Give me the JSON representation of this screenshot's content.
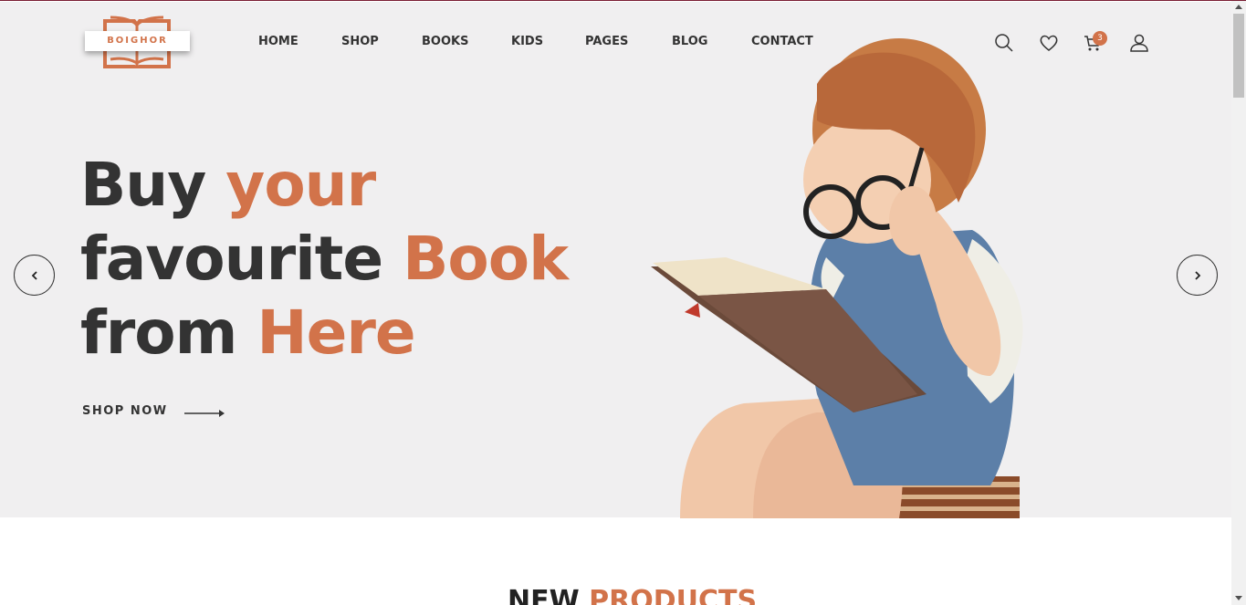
{
  "brand": {
    "name": "BOIGHOR",
    "accent_color": "#d2734a",
    "text_color": "#333333",
    "hero_background": "#f0eff0"
  },
  "nav": {
    "items": [
      {
        "label": "HOME"
      },
      {
        "label": "SHOP"
      },
      {
        "label": "BOOKS"
      },
      {
        "label": "KIDS"
      },
      {
        "label": "PAGES"
      },
      {
        "label": "BLOG"
      },
      {
        "label": "CONTACT"
      }
    ]
  },
  "header_icons": {
    "search": "search-icon",
    "wishlist": "heart-icon",
    "cart": "cart-icon",
    "cart_count": "3",
    "account": "user-icon"
  },
  "hero": {
    "line1_plain": "Buy ",
    "line1_accent": "your",
    "line2_plain": "favourite ",
    "line2_accent": "Book",
    "line3_plain": "from ",
    "line3_accent": "Here",
    "cta_label": "SHOP NOW",
    "prev_icon": "chevron-left-icon",
    "next_icon": "chevron-right-icon"
  },
  "section": {
    "title_plain": "NEW ",
    "title_accent": "PRODUCTS"
  }
}
